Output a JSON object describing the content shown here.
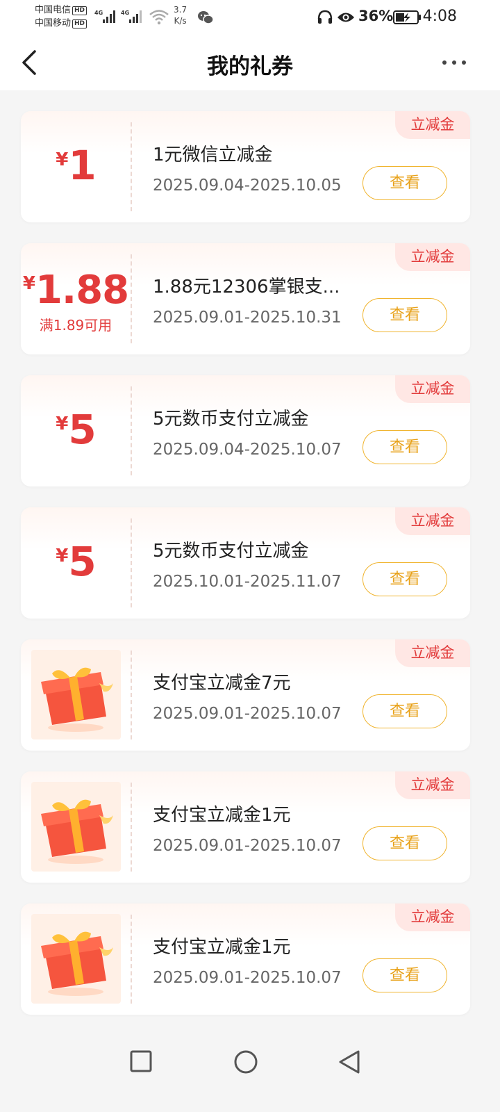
{
  "status_bar": {
    "carrier1": "中国电信",
    "carrier2": "中国移动",
    "hd_badge": "HD",
    "net_type": "4G",
    "net_speed_value": "3.7",
    "net_speed_unit": "K/s",
    "battery_percent": "36%",
    "time": "4:08"
  },
  "header": {
    "title": "我的礼券"
  },
  "coupons": [
    {
      "tag": "立减金",
      "currency": "¥",
      "amount": "1",
      "condition": "",
      "title": "1元微信立减金",
      "date": "2025.09.04-2025.10.05",
      "button": "查看"
    },
    {
      "tag": "立减金",
      "currency": "¥",
      "amount": "1.88",
      "condition": "满1.89可用",
      "title": "1.88元12306掌银支...",
      "date": "2025.09.01-2025.10.31",
      "button": "查看"
    },
    {
      "tag": "立减金",
      "currency": "¥",
      "amount": "5",
      "condition": "",
      "title": "5元数币支付立减金",
      "date": "2025.09.04-2025.10.07",
      "button": "查看"
    },
    {
      "tag": "立减金",
      "currency": "¥",
      "amount": "5",
      "condition": "",
      "title": "5元数币支付立减金",
      "date": "2025.10.01-2025.11.07",
      "button": "查看"
    },
    {
      "tag": "立减金",
      "icon": "gift-box-icon",
      "title": "支付宝立减金7元",
      "date": "2025.09.01-2025.10.07",
      "button": "查看"
    },
    {
      "tag": "立减金",
      "icon": "gift-box-icon",
      "title": "支付宝立减金1元",
      "date": "2025.09.01-2025.10.07",
      "button": "查看"
    },
    {
      "tag": "立减金",
      "icon": "gift-box-icon",
      "title": "支付宝立减金1元",
      "date": "2025.09.01-2025.10.07",
      "button": "查看"
    }
  ],
  "colors": {
    "price_red": "#e23b3b",
    "tag_bg": "#ffe7e4",
    "button_border": "#f0b42e",
    "button_text": "#e8a21a"
  }
}
